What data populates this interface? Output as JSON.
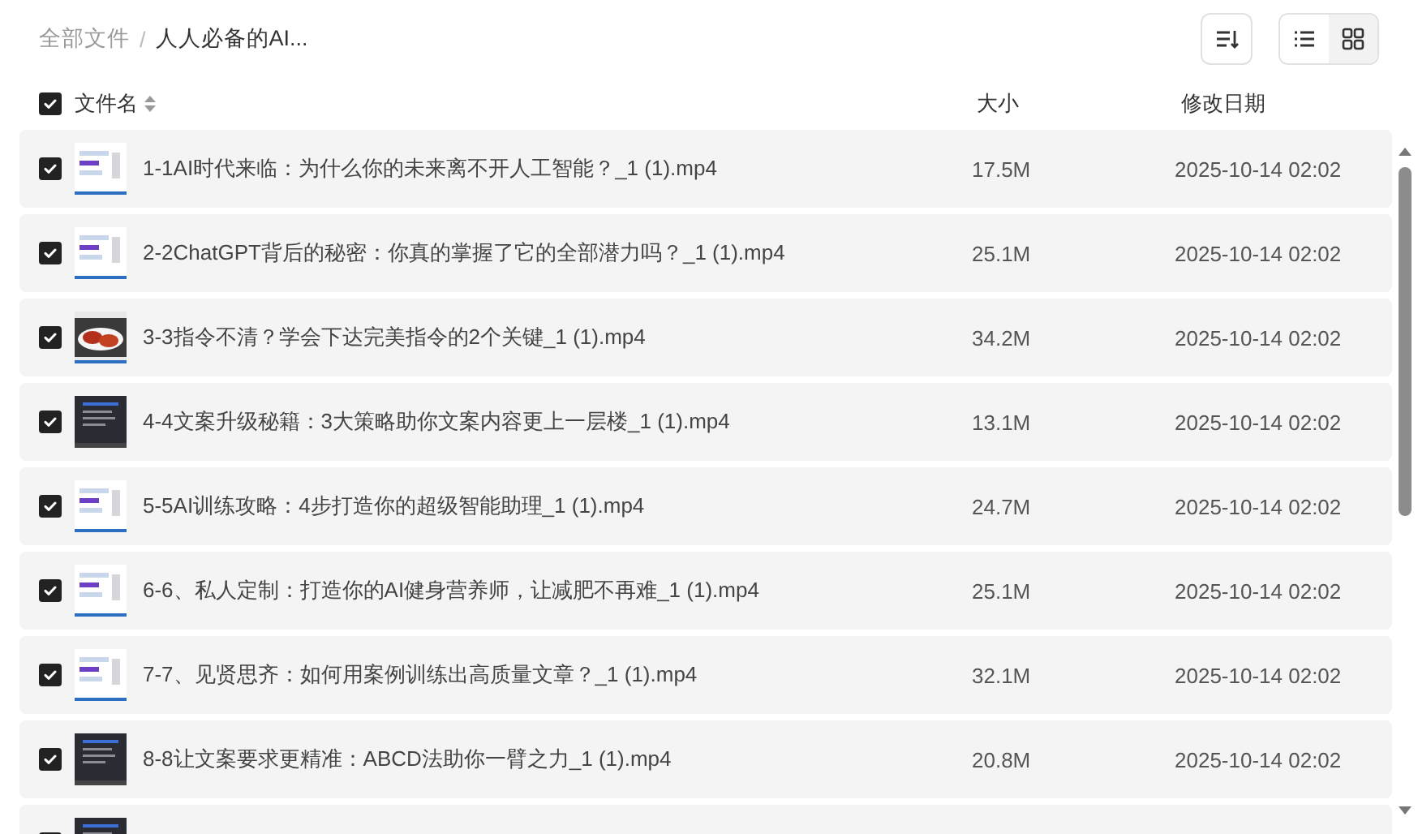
{
  "breadcrumb": [
    {
      "label": "全部文件",
      "current": false
    },
    {
      "label": "人人必备的AI...",
      "current": true
    }
  ],
  "breadcrumb_separator": "/",
  "toolbar": {
    "view_options": [
      {
        "kind": "list",
        "selected": false
      },
      {
        "kind": "grid",
        "selected": true
      }
    ]
  },
  "header": {
    "checked": true,
    "columns": [
      "文件名",
      "大小",
      "修改日期"
    ]
  },
  "files": [
    {
      "checked": true,
      "kind": "slide",
      "name": "1-1AI时代来临：为什么你的未来离不开人工智能？_1 (1).mp4",
      "size": "17.5M",
      "modified": "2025-10-14 02:02"
    },
    {
      "checked": true,
      "kind": "slide",
      "name": "2-2ChatGPT背后的秘密：你真的掌握了它的全部潜力吗？_1 (1).mp4",
      "size": "25.1M",
      "modified": "2025-10-14 02:02"
    },
    {
      "checked": true,
      "kind": "photo",
      "name": "3-3指令不清？学会下达完美指令的2个关键_1 (1).mp4",
      "size": "34.2M",
      "modified": "2025-10-14 02:02"
    },
    {
      "checked": true,
      "kind": "dark",
      "name": "4-4文案升级秘籍：3大策略助你文案内容更上一层楼_1 (1).mp4",
      "size": "13.1M",
      "modified": "2025-10-14 02:02"
    },
    {
      "checked": true,
      "kind": "slide",
      "name": "5-5AI训练攻略：4步打造你的超级智能助理_1 (1).mp4",
      "size": "24.7M",
      "modified": "2025-10-14 02:02"
    },
    {
      "checked": true,
      "kind": "slide",
      "name": "6-6、私人定制：打造你的AI健身营养师，让减肥不再难_1 (1).mp4",
      "size": "25.1M",
      "modified": "2025-10-14 02:02"
    },
    {
      "checked": true,
      "kind": "slide",
      "name": "7-7、见贤思齐：如何用案例训练出高质量文章？_1 (1).mp4",
      "size": "32.1M",
      "modified": "2025-10-14 02:02"
    },
    {
      "checked": true,
      "kind": "dark",
      "name": "8-8让文案要求更精准：ABCD法助你一臂之力_1 (1).mp4",
      "size": "20.8M",
      "modified": "2025-10-14 02:02"
    },
    {
      "checked": true,
      "kind": "dark"
    }
  ]
}
